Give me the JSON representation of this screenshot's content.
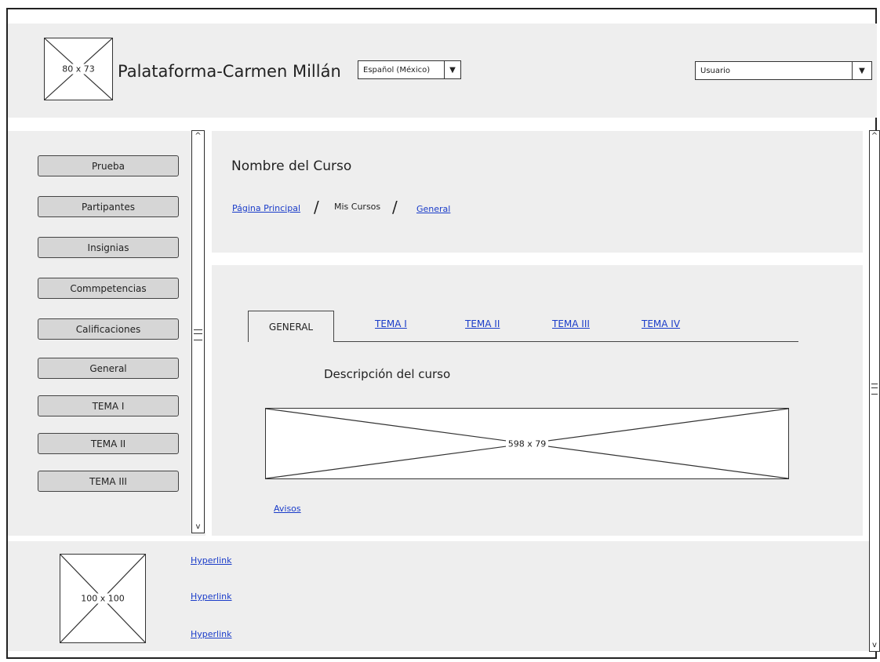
{
  "header": {
    "logo_placeholder": "80 x 73",
    "app_title": "Palataforma-Carmen Millán",
    "language_select": "Español (México)",
    "user_select": "Usuario",
    "dropdown_glyph": "▼"
  },
  "sidebar": {
    "items": [
      {
        "label": "Prueba"
      },
      {
        "label": "Partipantes"
      },
      {
        "label": "Insignias"
      },
      {
        "label": "Commpetencias"
      },
      {
        "label": "Calificaciones"
      },
      {
        "label": "General"
      },
      {
        "label": "TEMA I"
      },
      {
        "label": "TEMA II"
      },
      {
        "label": "TEMA III"
      }
    ]
  },
  "course_header": {
    "title": "Nombre del Curso",
    "breadcrumb": {
      "home": "Página Principal",
      "mine": "Mis Cursos",
      "current": "General",
      "separator": "/"
    }
  },
  "content": {
    "tabs": [
      {
        "label": "GENERAL",
        "active": true
      },
      {
        "label": "TEMA I"
      },
      {
        "label": "TEMA II"
      },
      {
        "label": "TEMA III"
      },
      {
        "label": "TEMA IV"
      }
    ],
    "description_heading": "Descripción del curso",
    "banner_placeholder": "598 x 79",
    "notices_link": "Avisos"
  },
  "footer": {
    "image_placeholder": "100 x 100",
    "links": [
      "Hyperlink",
      "Hyperlink",
      "Hyperlink"
    ]
  },
  "scroll_glyphs": {
    "up": "^",
    "down": "v"
  }
}
